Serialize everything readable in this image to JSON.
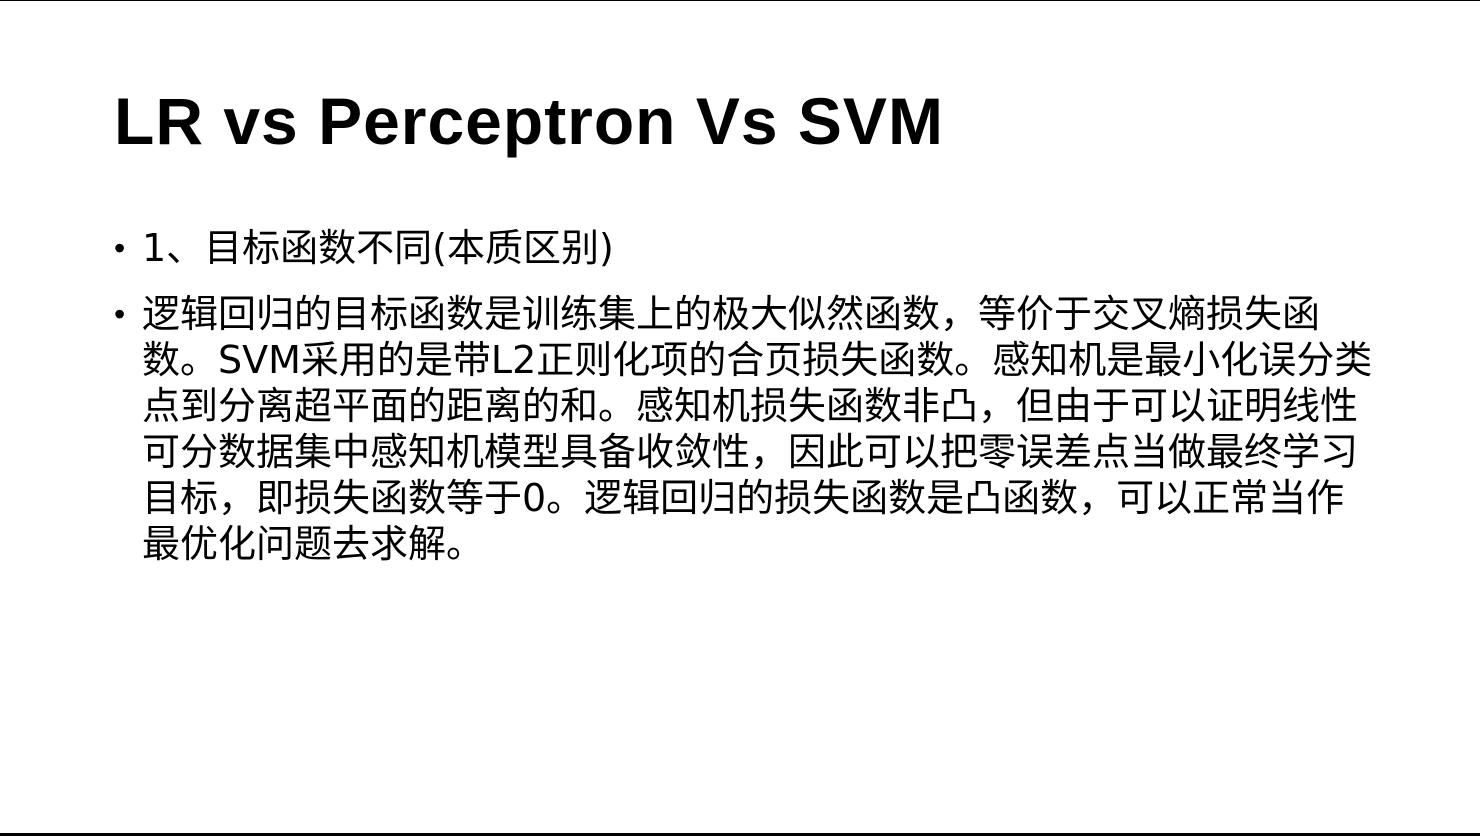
{
  "slide": {
    "title": "LR vs Perceptron Vs SVM",
    "bullets": [
      {
        "marker": "•",
        "text": "1、目标函数不同(本质区别)"
      },
      {
        "marker": "•",
        "text": "逻辑回归的目标函数是训练集上的极大似然函数，等价于交叉熵损失函数。SVM采用的是带L2正则化项的合页损失函数。感知机是最小化误分类点到分离超平面的距离的和。感知机损失函数非凸，但由于可以证明线性可分数据集中感知机模型具备收敛性，因此可以把零误差点当做最终学习目标，即损失函数等于0。逻辑回归的损失函数是凸函数，可以正常当作最优化问题去求解。"
      }
    ]
  }
}
